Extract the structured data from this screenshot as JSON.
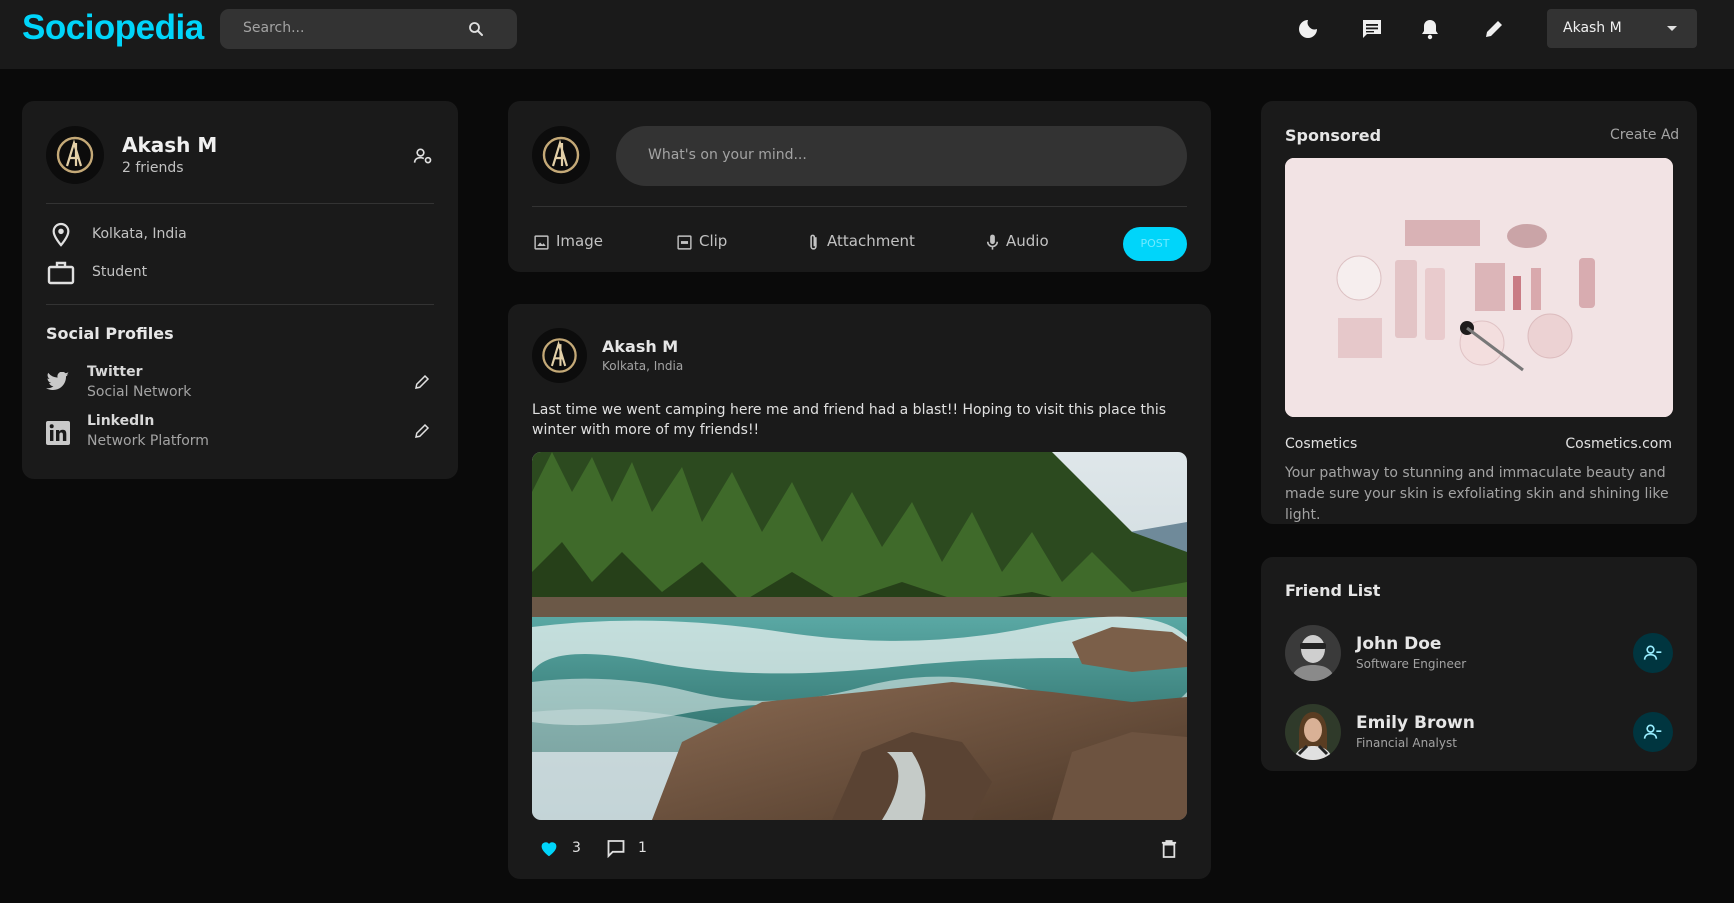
{
  "navbar": {
    "logo": "Sociopedia",
    "search_placeholder": "Search...",
    "user_menu_label": "Akash M",
    "icons": [
      "moon-icon",
      "message-icon",
      "bell-icon",
      "pencil-icon"
    ]
  },
  "colors": {
    "accent": "#00d5fa",
    "background": "#0a0a0a",
    "card": "#1a1a1a",
    "input": "#333333"
  },
  "user_card": {
    "name": "Akash M",
    "friends": "2 friends",
    "location": "Kolkata, India",
    "occupation": "Student",
    "social_title": "Social Profiles",
    "socials": [
      {
        "name": "Twitter",
        "type": "Social Network"
      },
      {
        "name": "LinkedIn",
        "type": "Network Platform"
      }
    ]
  },
  "composer": {
    "placeholder": "What's on your mind...",
    "actions": [
      "Image",
      "Clip",
      "Attachment",
      "Audio"
    ],
    "post_label": "POST"
  },
  "post": {
    "author": "Akash M",
    "location": "Kolkata, India",
    "text": "Last time we went camping here me and friend had a blast!! Hoping to visit this place this winter with more of my friends!!",
    "likes": "3",
    "comments": "1"
  },
  "sponsored": {
    "title": "Sponsored",
    "create_ad": "Create Ad",
    "brand": "Cosmetics",
    "site": "Cosmetics.com",
    "description": "Your pathway to stunning and immaculate beauty and made sure your skin is exfoliating skin and shining like light."
  },
  "friend_list": {
    "title": "Friend List",
    "friends": [
      {
        "name": "John Doe",
        "role": "Software Engineer"
      },
      {
        "name": "Emily Brown",
        "role": "Financial Analyst"
      }
    ]
  }
}
